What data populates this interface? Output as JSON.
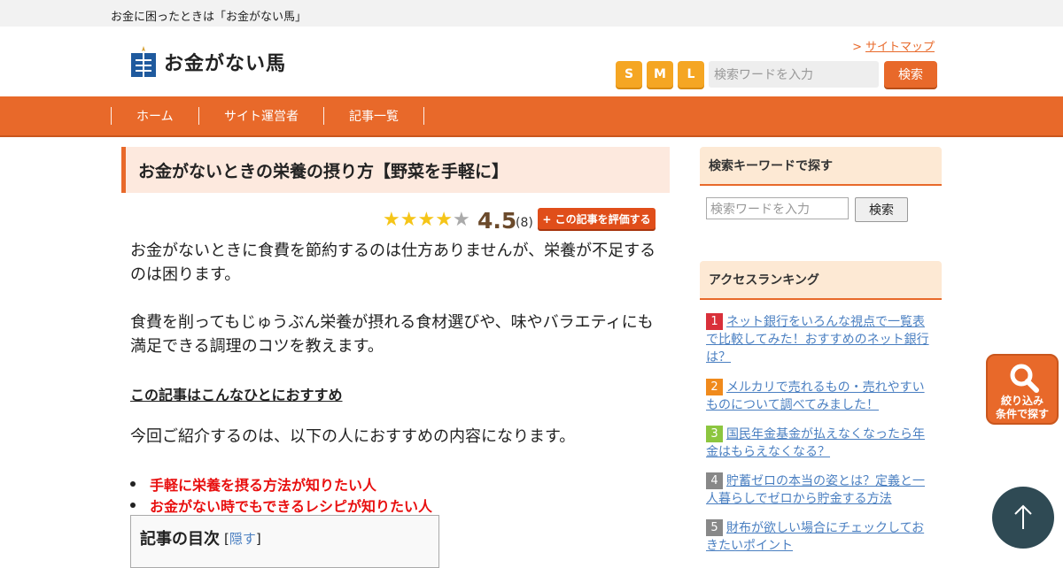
{
  "topbar": {
    "tagline": "お金に困ったときは「お金がない馬」"
  },
  "header": {
    "site_name": "お金がない馬",
    "sitemap_prefix": ">",
    "sitemap_label": "サイトマップ",
    "font_sizes": [
      "S",
      "M",
      "L"
    ],
    "search_placeholder": "検索ワードを入力",
    "search_button": "検索"
  },
  "nav": {
    "items": [
      "ホーム",
      "サイト運営者",
      "記事一覧"
    ]
  },
  "article": {
    "title": "お金がないときの栄養の摂り方【野菜を手軽に】",
    "rating_value": "4.5",
    "rating_count": "(8)",
    "rating_stars": 4.5,
    "rate_button": "+ この記事を評価する",
    "para1": "お金がないときに食費を節約するのは仕方ありませんが、栄養が不足するのは困ります。",
    "para2": "食費を削ってもじゅうぶん栄養が摂れる食材選びや、味やバラエティにも満足できる調理のコツを教えます。",
    "recommend_heading": "この記事はこんなひとにおすすめ",
    "para3": "今回ご紹介するのは、以下の人におすすめの内容になります。",
    "bullets": [
      "手軽に栄養を摂る方法が知りたい人",
      "お金がない時でもできるレシピが知りたい人"
    ],
    "toc_title": "記事の目次",
    "toc_open": "[",
    "toc_toggle": "隠す",
    "toc_close": "]"
  },
  "sidebar": {
    "search_heading": "検索キーワードで探す",
    "search_placeholder": "検索ワードを入力",
    "search_button": "検索",
    "ranking_heading": "アクセスランキング",
    "ranking": [
      {
        "rank": "1",
        "color": "#d9303a",
        "title": "ネット銀行をいろんな視点で一覧表で比較してみた！おすすめのネット銀行は？"
      },
      {
        "rank": "2",
        "color": "#f08a1c",
        "title": "メルカリで売れるもの・売れやすいものについて調べてみました！"
      },
      {
        "rank": "3",
        "color": "#8cc63f",
        "title": "国民年金基金が払えなくなったら年金はもらえなくなる？"
      },
      {
        "rank": "4",
        "color": "#888888",
        "title": "貯蓄ゼロの本当の姿とは？定義と一人暮らしでゼロから貯金する方法"
      },
      {
        "rank": "5",
        "color": "#888888",
        "title": "財布が欲しい場合にチェックしておきたいポイント"
      }
    ]
  },
  "floating": {
    "filter_label_1": "絞り込み",
    "filter_label_2": "条件で探す"
  },
  "colors": {
    "accent": "#e8692a",
    "star": "#f5c518",
    "link": "#4a7fc1"
  }
}
